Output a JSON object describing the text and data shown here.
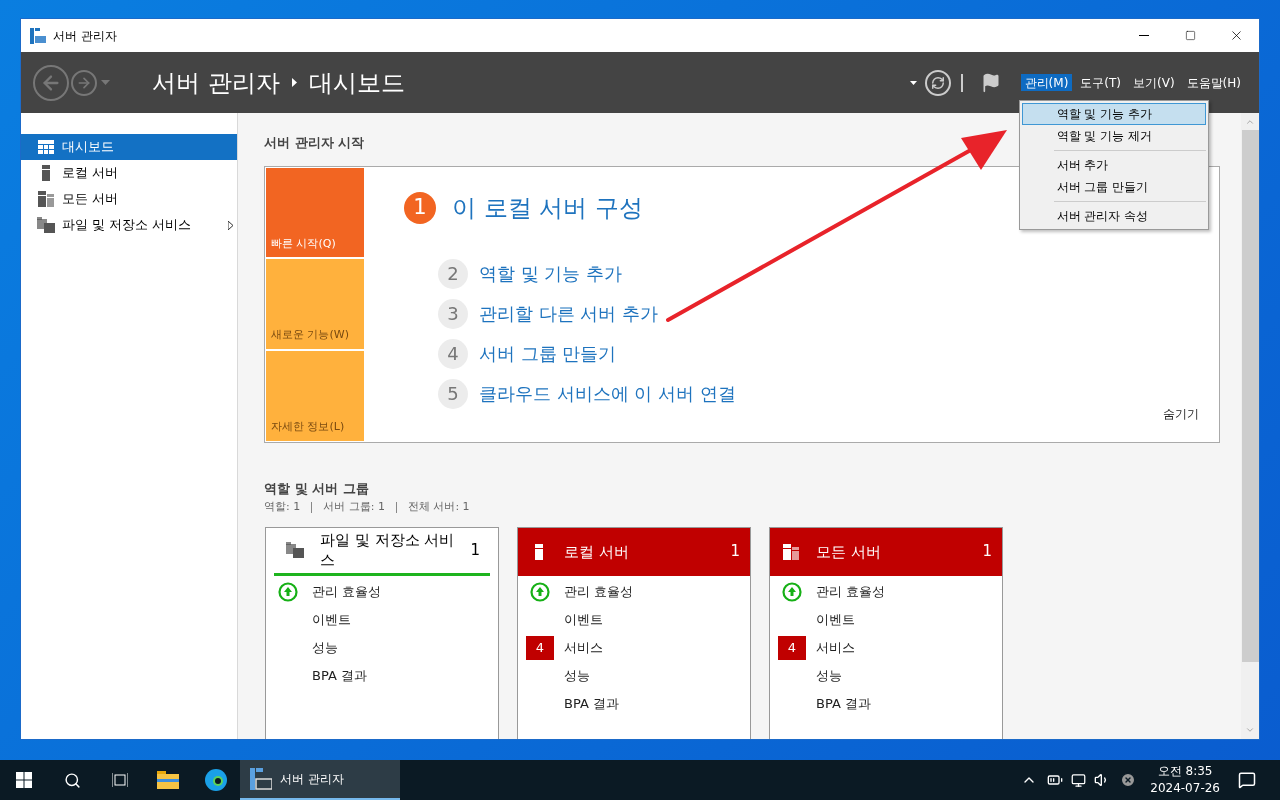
{
  "window": {
    "title": "서버 관리자"
  },
  "header": {
    "breadcrumb": [
      "서버 관리자",
      "대시보드"
    ],
    "menus": [
      {
        "label": "관리(M)",
        "selected": true
      },
      {
        "label": "도구(T)",
        "selected": false
      },
      {
        "label": "보기(V)",
        "selected": false
      },
      {
        "label": "도움말(H)",
        "selected": false
      }
    ]
  },
  "dropdown": [
    {
      "kind": "item",
      "label": "역할 및 기능 추가",
      "selected": true
    },
    {
      "kind": "item",
      "label": "역할 및 기능 제거",
      "selected": false
    },
    {
      "kind": "separator"
    },
    {
      "kind": "item",
      "label": "서버 추가",
      "selected": false
    },
    {
      "kind": "item",
      "label": "서버 그룹 만들기",
      "selected": false
    },
    {
      "kind": "separator"
    },
    {
      "kind": "item",
      "label": "서버 관리자 속성",
      "selected": false
    }
  ],
  "sidebar": {
    "items": [
      {
        "label": "대시보드",
        "kind": "dashboard",
        "selected": true,
        "expandable": false
      },
      {
        "label": "로컬 서버",
        "kind": "server",
        "selected": false,
        "expandable": false
      },
      {
        "label": "모든 서버",
        "kind": "servers",
        "selected": false,
        "expandable": false
      },
      {
        "label": "파일 및 저장소 서비스",
        "kind": "files",
        "selected": false,
        "expandable": true
      }
    ]
  },
  "welcome": {
    "title": "서버 관리자 시작",
    "tiles": [
      {
        "label": "빠른 시작(Q)",
        "selected": true
      },
      {
        "label": "새로운 기능(W)",
        "selected": false
      },
      {
        "label": "자세한 정보(L)",
        "selected": false
      }
    ],
    "steps": [
      {
        "kind": "primary",
        "number": "1",
        "label": "이 로컬 서버 구성"
      },
      {
        "kind": "secondary",
        "number": "2",
        "label": "역할 및 기능 추가"
      },
      {
        "kind": "secondary",
        "number": "3",
        "label": "관리할 다른 서버 추가"
      },
      {
        "kind": "secondary",
        "number": "4",
        "label": "서버 그룹 만들기"
      },
      {
        "kind": "secondary",
        "number": "5",
        "label": "클라우드 서비스에 이 서버 연결"
      }
    ],
    "hide_link": "숨기기"
  },
  "roles": {
    "title": "역할 및 서버 그룹",
    "summary": [
      "역할: 1",
      "서버 그룹: 1",
      "전체 서버: 1"
    ],
    "cards": [
      {
        "title": "파일 및 저장소 서비스",
        "kind": "files",
        "count": "1",
        "alert": false,
        "rows": [
          {
            "label": "관리 효율성",
            "kind": "ok"
          },
          {
            "label": "이벤트",
            "kind": "plain"
          },
          {
            "label": "성능",
            "kind": "plain"
          },
          {
            "label": "BPA 결과",
            "kind": "plain"
          }
        ]
      },
      {
        "title": "로컬 서버",
        "kind": "server",
        "count": "1",
        "alert": true,
        "rows": [
          {
            "label": "관리 효율성",
            "kind": "ok"
          },
          {
            "label": "이벤트",
            "kind": "plain"
          },
          {
            "label": "서비스",
            "kind": "badge",
            "badge": "4"
          },
          {
            "label": "성능",
            "kind": "plain"
          },
          {
            "label": "BPA 결과",
            "kind": "plain"
          }
        ]
      },
      {
        "title": "모든 서버",
        "kind": "servers",
        "count": "1",
        "alert": true,
        "rows": [
          {
            "label": "관리 효율성",
            "kind": "ok"
          },
          {
            "label": "이벤트",
            "kind": "plain"
          },
          {
            "label": "서비스",
            "kind": "badge",
            "badge": "4"
          },
          {
            "label": "성능",
            "kind": "plain"
          },
          {
            "label": "BPA 결과",
            "kind": "plain"
          }
        ]
      }
    ]
  },
  "taskbar": {
    "app": "서버 관리자",
    "time": "오전 8:35",
    "date": "2024-07-26"
  }
}
